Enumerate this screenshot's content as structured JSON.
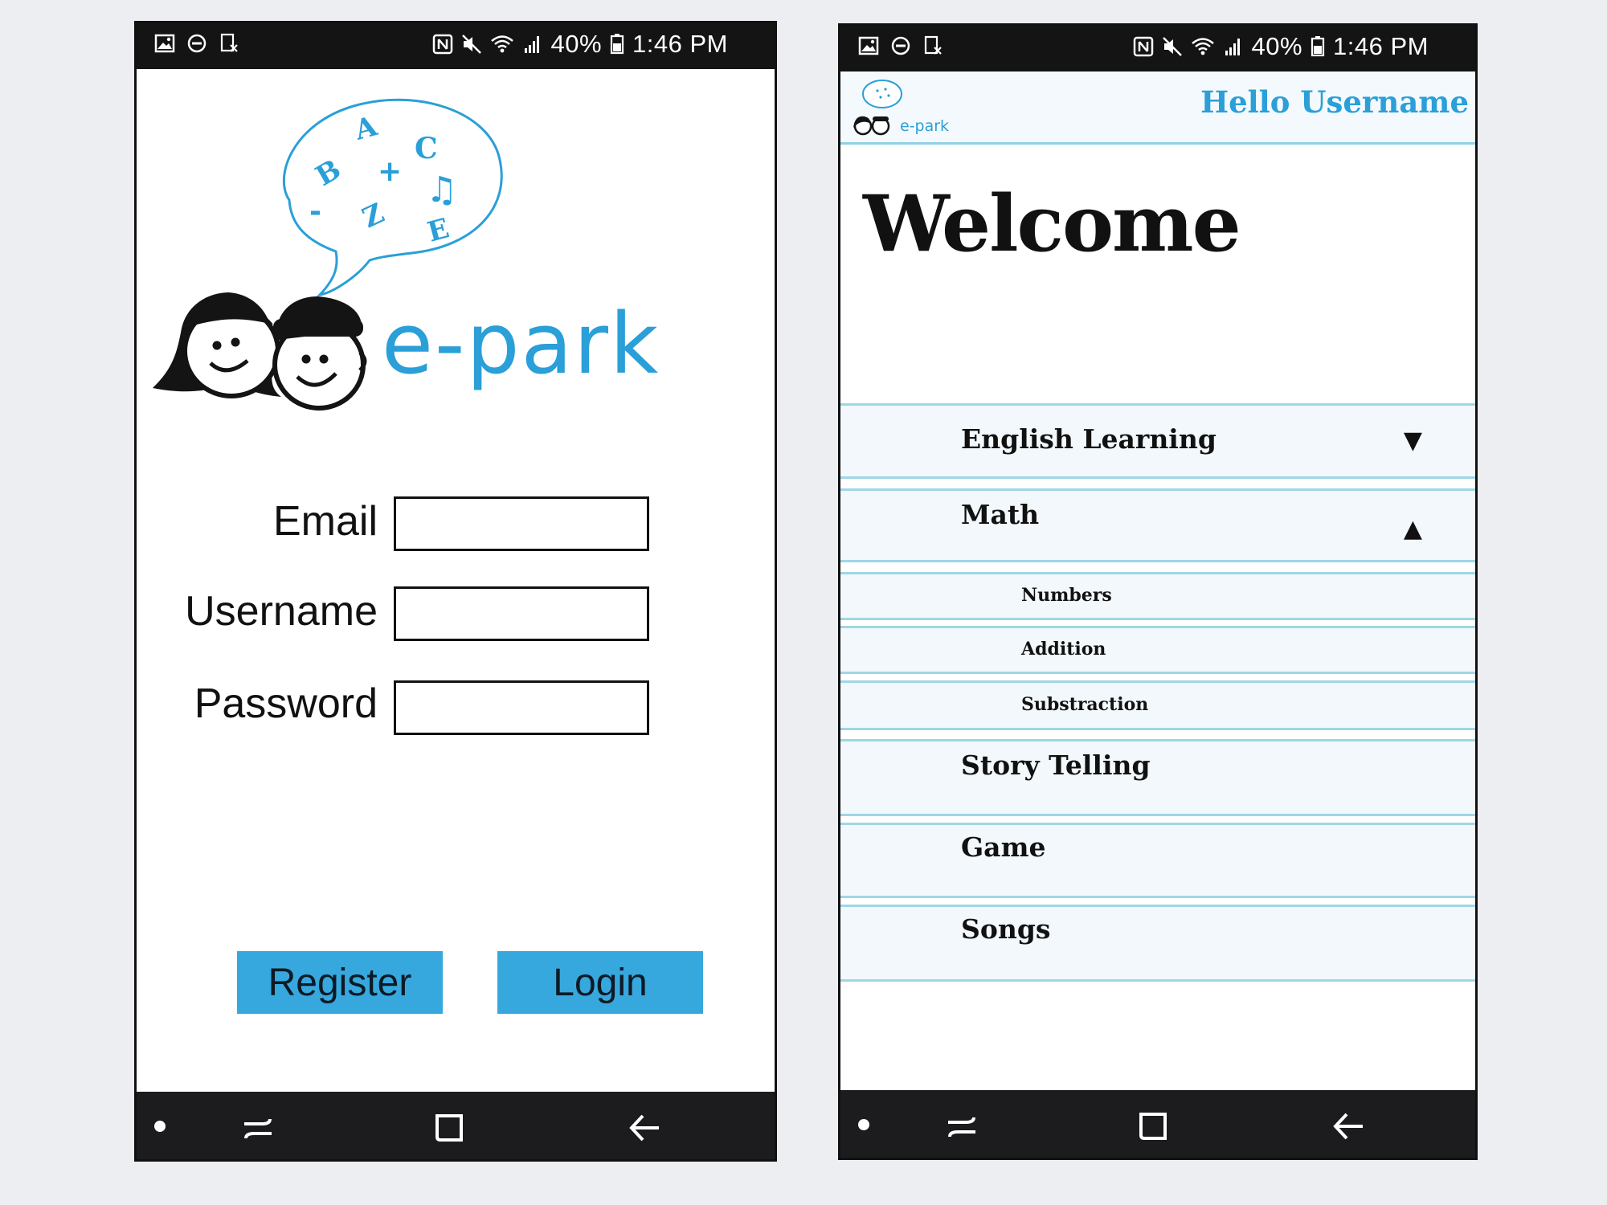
{
  "status_bar": {
    "battery_percent": "40%",
    "time": "1:46 PM",
    "left_icons": [
      "gallery-icon",
      "dnd-icon",
      "screenshot-icon"
    ],
    "right_icons": [
      "nfc-icon",
      "mute-icon",
      "wifi-icon",
      "signal-icon",
      "battery-icon"
    ]
  },
  "login": {
    "logo": {
      "brand": "e-park",
      "bubble_letters": [
        "A",
        "C",
        "B",
        "+",
        "♫",
        "-",
        "Z",
        "E"
      ]
    },
    "fields": [
      {
        "label": "Email",
        "value": "",
        "placeholder": ""
      },
      {
        "label": "Username",
        "value": "",
        "placeholder": ""
      },
      {
        "label": "Password",
        "value": "",
        "placeholder": ""
      }
    ],
    "buttons": {
      "register": "Register",
      "login": "Login"
    }
  },
  "menu": {
    "header": {
      "brand": "e-park",
      "greeting": "Hello Username"
    },
    "welcome": "Welcome",
    "items": [
      {
        "label": "English Learning",
        "arrow": "▼",
        "expanded": false
      },
      {
        "label": "Math",
        "arrow": "▲",
        "expanded": true
      },
      {
        "label": "Numbers"
      },
      {
        "label": "Addition"
      },
      {
        "label": "Substraction"
      },
      {
        "label": "Story Telling"
      },
      {
        "label": "Game"
      },
      {
        "label": "Songs"
      }
    ]
  },
  "nav_bar": {
    "icons": [
      "home-dot-icon",
      "recents-icon",
      "home-icon",
      "back-icon"
    ]
  },
  "colors": {
    "accent": "#36a8de",
    "brand_text": "#2a9fd8",
    "menu_bg": "#f2f8fb",
    "menu_border": "#9fd6e6"
  }
}
